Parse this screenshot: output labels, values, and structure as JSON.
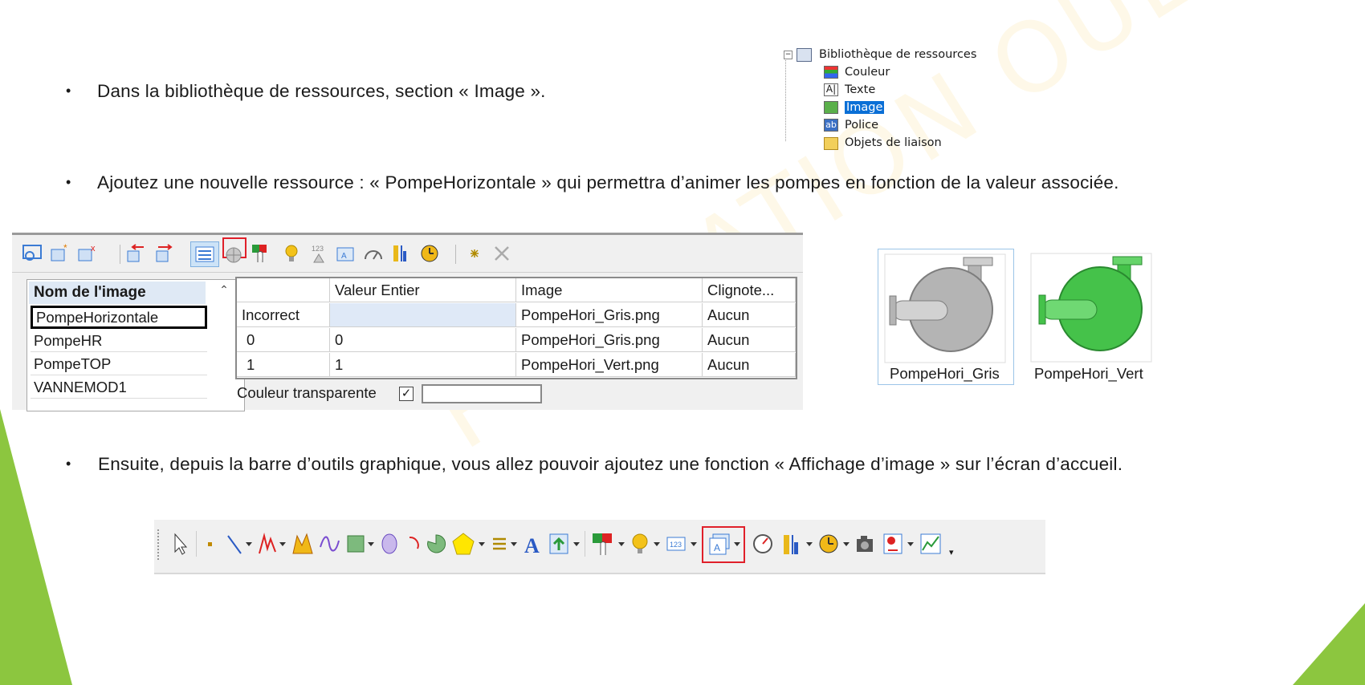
{
  "bullets": {
    "b1": "Dans la bibliothèque de ressources, section « Image ».",
    "b2": "Ajoutez une nouvelle ressource : « PompeHorizontale » qui permettra d’animer les pompes en fonction de la valeur associée.",
    "b3": "Ensuite, depuis la barre d’outils graphique, vous allez pouvoir ajoutez une fonction « Affichage d’image » sur l’écran d’accueil.",
    "marker": "•"
  },
  "tree": {
    "root": "Bibliothèque de ressources",
    "items": [
      {
        "label": "Couleur",
        "icon": "palette-icon"
      },
      {
        "label": "Texte",
        "icon": "text-resource-icon"
      },
      {
        "label": "Image",
        "icon": "image-resource-icon",
        "selected": true
      },
      {
        "label": "Police",
        "icon": "font-resource-icon"
      },
      {
        "label": "Objets de liaison",
        "icon": "folder-icon"
      }
    ]
  },
  "image_list": {
    "header": "Nom de l'image",
    "items": [
      "PompeHorizontale",
      "PompeHR",
      "PompeTOP",
      "VANNEMOD1"
    ],
    "selected": "PompeHorizontale"
  },
  "grid": {
    "columns": [
      "",
      "Valeur Entier",
      "Image",
      "Clignote..."
    ],
    "rows": [
      [
        "Incorrect",
        "",
        "PompeHori_Gris.png",
        "Aucun"
      ],
      [
        "0",
        "0",
        "PompeHori_Gris.png",
        "Aucun"
      ],
      [
        "1",
        "1",
        "PompeHori_Vert.png",
        "Aucun"
      ]
    ],
    "transparent_label": "Couleur transparente",
    "transparent_checked": true
  },
  "thumbs": [
    {
      "label": "PompeHori_Gris",
      "color": "#b4b4b4",
      "dark": "#7d7d7d"
    },
    {
      "label": "PompeHori_Vert",
      "color": "#45c24a",
      "dark": "#2a8a30"
    }
  ],
  "watermark": "FORMATION OUEST",
  "colors": {
    "accent_green": "#8cc63f",
    "highlight_red": "#e0202a",
    "selection_blue": "#0a6fd6"
  }
}
